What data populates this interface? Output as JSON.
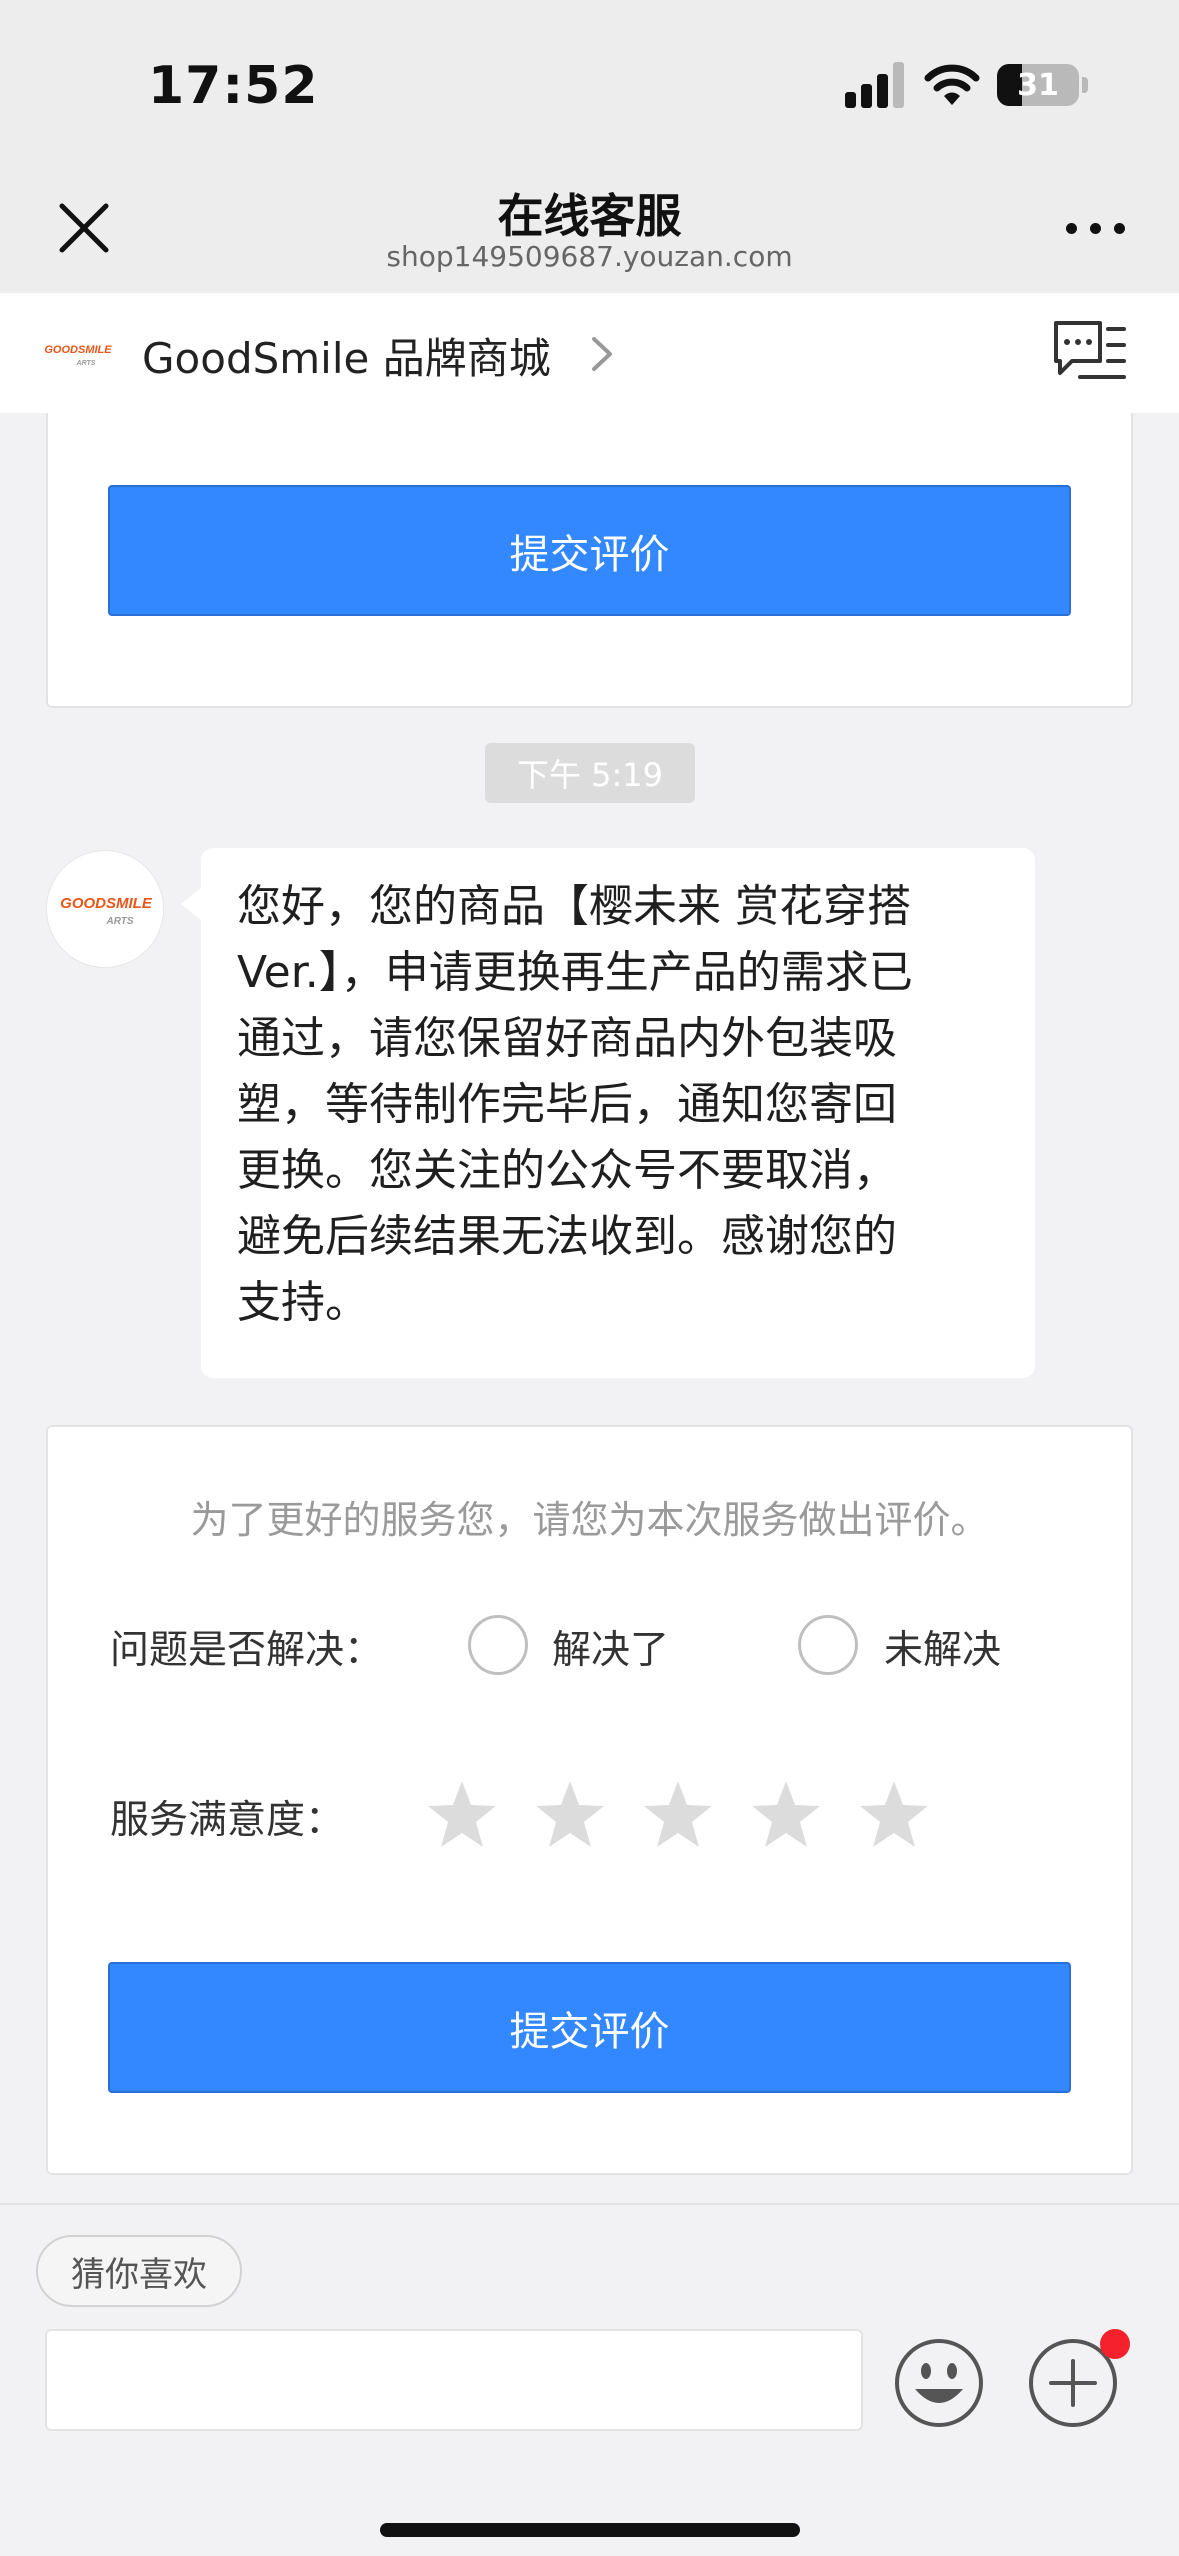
{
  "status_bar": {
    "time": "17:52",
    "battery": "31",
    "icons": [
      "signal-icon",
      "wifi-icon",
      "battery-icon"
    ]
  },
  "nav": {
    "title": "在线客服",
    "subtitle": "shop149509687.youzan.com",
    "close_icon": "close-icon",
    "more_icon": "more-icon"
  },
  "shop": {
    "logo_text": "GOODSMILE",
    "logo_sub": "ARTS",
    "name": "GoodSmile 品牌商城",
    "chevron_icon": "chevron-right-icon",
    "messages_icon": "message-list-icon"
  },
  "chat": {
    "first_card": {
      "submit_label": "提交评价"
    },
    "timestamp": "下午 5:19",
    "message": {
      "avatar_text": "GOODSMILE",
      "avatar_sub": "ARTS",
      "lines": [
        "您好，您的商品【樱未来 赏花穿搭",
        "Ver.】，申请更换再生产品的需求已",
        "通过，请您保留好商品内外包装吸",
        "塑，等待制作完毕后，通知您寄回",
        "更换。您关注的公众号不要取消，",
        "避免后续结果无法收到。感谢您的",
        "支持。"
      ]
    },
    "rating_card": {
      "intro": "为了更好的服务您，请您为本次服务做出评价。",
      "resolved_label": "问题是否解决：",
      "option_resolved": "解决了",
      "option_unresolved": "未解决",
      "satisfaction_label": "服务满意度：",
      "stars_total": 5,
      "stars_selected": 0,
      "submit_label": "提交评价"
    }
  },
  "bottom_bar": {
    "suggestion_chip": "猜你喜欢",
    "input_value": "",
    "emoji_icon": "emoji-icon",
    "plus_icon": "plus-icon",
    "has_notification": true
  },
  "colors": {
    "accent": "#3388ff",
    "background": "#f2f2f4",
    "notification": "#f5222d",
    "star_empty": "#dcdcdc"
  }
}
